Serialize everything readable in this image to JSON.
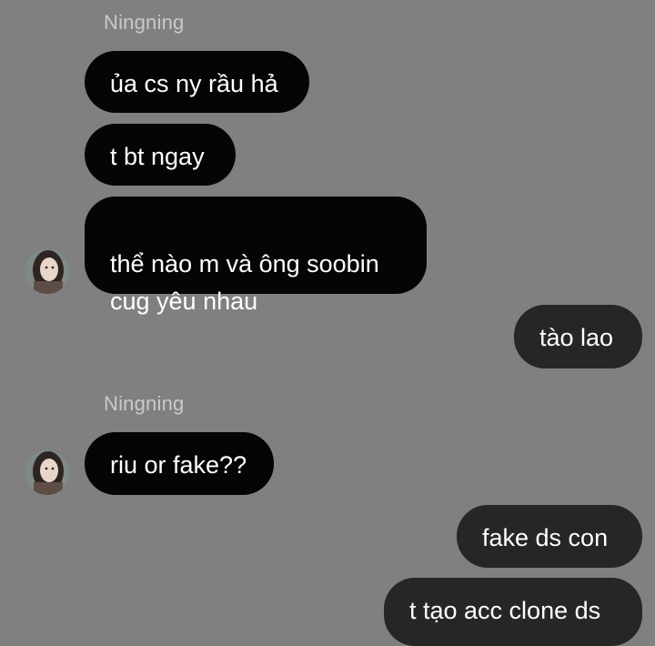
{
  "conversation": {
    "groups": [
      {
        "sender": "Ningning",
        "messages": [
          "ủa cs ny rầu hả",
          "t bt ngay",
          "thể nào m và ông soobin\ncug yêu nhau"
        ]
      },
      {
        "sender": "Ningning",
        "messages": [
          "riu or fake??"
        ]
      }
    ],
    "outgoing": [
      "tào lao",
      "fake ds con",
      "t tạo acc clone ds"
    ]
  },
  "colors": {
    "background": "#808080",
    "incoming_bubble": "#050505",
    "outgoing_bubble": "#262626",
    "sender_name": "#c9c9c9"
  }
}
